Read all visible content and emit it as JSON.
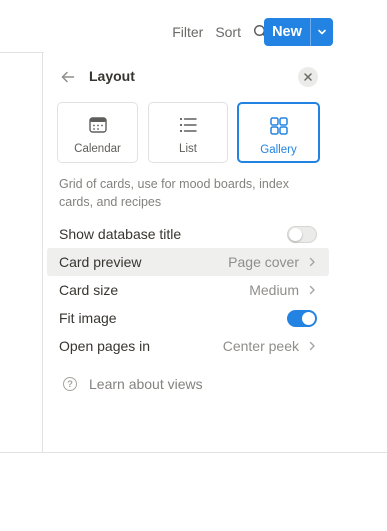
{
  "toolbar": {
    "filter_label": "Filter",
    "sort_label": "Sort",
    "search_icon": "search-icon",
    "expand_icon": "expand-icon",
    "more_icon": "more-horizontal-icon",
    "new_label": "New",
    "accent_color": "#2383e2"
  },
  "panel": {
    "title": "Layout",
    "back_icon": "arrow-left-icon",
    "close_icon": "close-icon",
    "layouts": [
      {
        "label": "Calendar",
        "icon": "calendar-icon",
        "selected": false
      },
      {
        "label": "List",
        "icon": "list-icon",
        "selected": false
      },
      {
        "label": "Gallery",
        "icon": "gallery-icon",
        "selected": true
      }
    ],
    "description": "Grid of cards, use for mood boards, index cards, and recipes",
    "settings": {
      "show_db_title": {
        "label": "Show database title",
        "enabled": false
      },
      "card_preview": {
        "label": "Card preview",
        "value": "Page cover"
      },
      "card_size": {
        "label": "Card size",
        "value": "Medium"
      },
      "fit_image": {
        "label": "Fit image",
        "enabled": true
      },
      "open_pages": {
        "label": "Open pages in",
        "value": "Center peek"
      }
    },
    "learn_link": "Learn about views"
  }
}
